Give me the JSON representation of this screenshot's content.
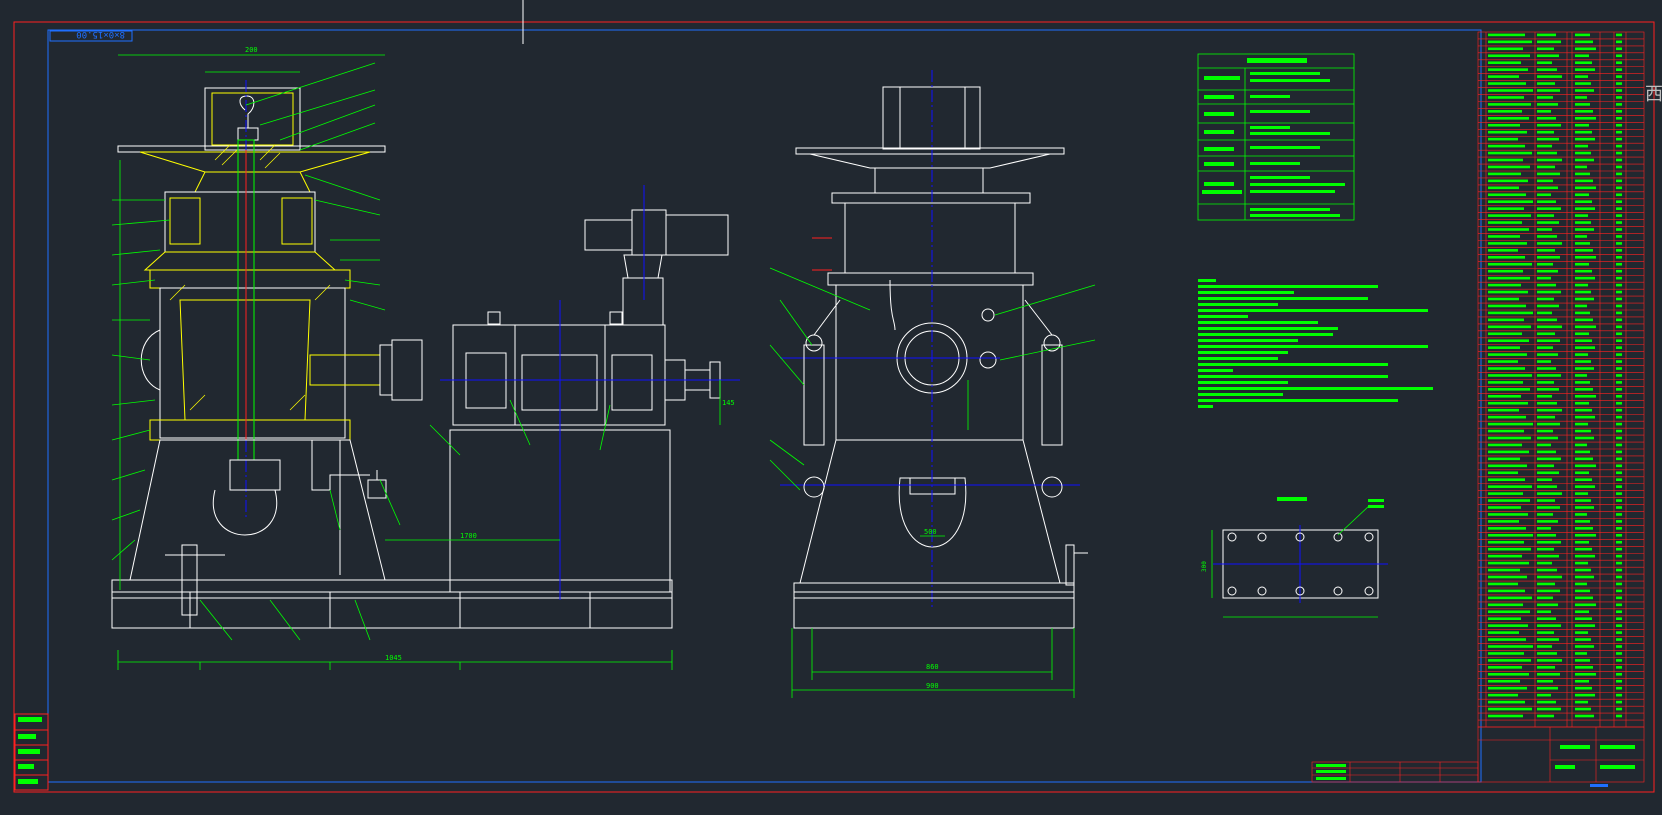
{
  "drawing": {
    "frame_code": "8×0×15.00",
    "side_mark": "西",
    "colors": {
      "background": "#212830",
      "outline": "#ffffff",
      "annotation": "#00ff00",
      "centerline": "#1010ff",
      "yellow": "#ffff00",
      "frame": "#ff2020",
      "inner_border": "#1f6fff"
    },
    "front_view_dimensions": [
      "200",
      "1045",
      "1700",
      "145"
    ],
    "side_view_dimensions": [
      "860",
      "900"
    ],
    "side_view_label": "500",
    "plan_view_title": "",
    "plan_view_dimension": "300"
  }
}
